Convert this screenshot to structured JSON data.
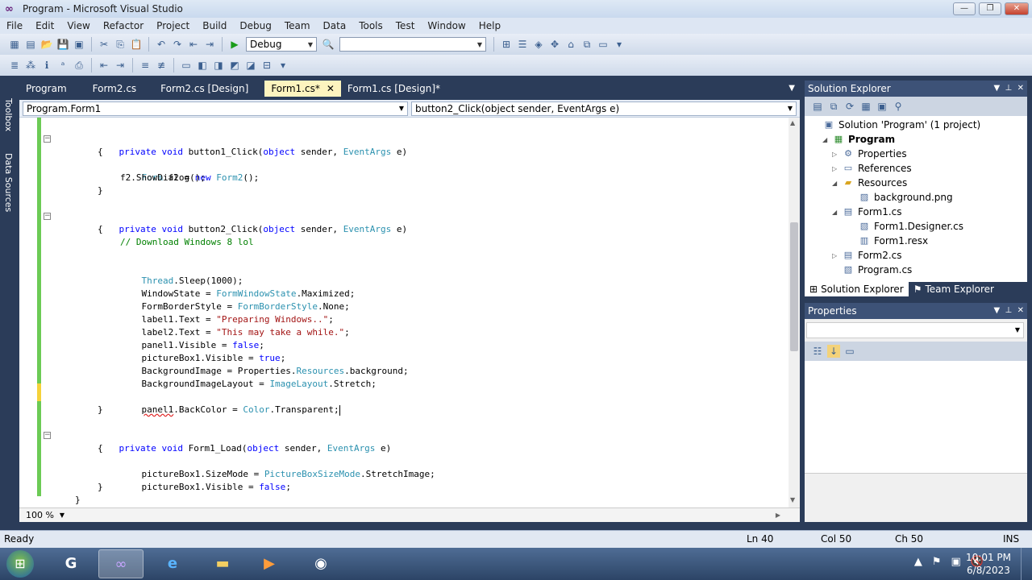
{
  "window": {
    "title": "Program - Microsoft Visual Studio",
    "app_icon": "vs-infinity-icon"
  },
  "menu": [
    "File",
    "Edit",
    "View",
    "Refactor",
    "Project",
    "Build",
    "Debug",
    "Team",
    "Data",
    "Tools",
    "Test",
    "Window",
    "Help"
  ],
  "toolbar": {
    "config": "Debug",
    "platform": ""
  },
  "left_strip": {
    "toolbox": "Toolbox",
    "data_sources": "Data Sources"
  },
  "doc_tabs": [
    {
      "label": "Program",
      "active": false
    },
    {
      "label": "Form2.cs",
      "active": false
    },
    {
      "label": "Form2.cs [Design]",
      "active": false
    },
    {
      "label": "Form1.cs*",
      "active": true
    },
    {
      "label": "Form1.cs [Design]*",
      "active": false
    }
  ],
  "nav": {
    "class_combo": "Program.Form1",
    "member_combo": "button2_Click(object sender, EventArgs e)"
  },
  "code": {
    "l01": "private void button1_Click(object sender, EventArgs e)",
    "l02": "{",
    "l03": "Form f2 = new Form2();",
    "l04": "f2.ShowDialog();",
    "l05": "}",
    "l06": "private void button2_Click(object sender, EventArgs e)",
    "l07": "{",
    "l08": "// Download Windows 8 lol",
    "l09": "Thread.Sleep(1000);",
    "l10": "WindowState = FormWindowState.Maximized;",
    "l11": "FormBorderStyle = FormBorderStyle.None;",
    "l12": "label1.Text = \"Preparing Windows..\";",
    "l13": "label2.Text = \"This may take a while.\";",
    "l14": "panel1.Visible = false;",
    "l15": "pictureBox1.Visible = true;",
    "l16": "BackgroundImage = Properties.Resources.background;",
    "l17": "BackgroundImageLayout = ImageLayout.Stretch;",
    "l18": "panel1.BackColor = Color.Transparent;",
    "l19": "}",
    "l20": "private void Form1_Load(object sender, EventArgs e)",
    "l21": "{",
    "l22": "pictureBox1.SizeMode = PictureBoxSizeMode.StretchImage;",
    "l23": "pictureBox1.Visible = false;",
    "l24": "}",
    "l25": "}"
  },
  "editor": {
    "zoom": "100 %"
  },
  "solution_explorer": {
    "title": "Solution Explorer",
    "tree": [
      {
        "label": "Solution 'Program' (1 project)",
        "icon": "solution-icon",
        "expander": "",
        "selected": false
      },
      {
        "label": "Program",
        "icon": "csharp-project-icon",
        "expander": "◢",
        "selected": true
      },
      {
        "label": "Properties",
        "icon": "properties-icon",
        "expander": "▷",
        "selected": false
      },
      {
        "label": "References",
        "icon": "references-icon",
        "expander": "▷",
        "selected": false
      },
      {
        "label": "Resources",
        "icon": "folder-icon",
        "expander": "◢",
        "selected": false
      },
      {
        "label": "background.png",
        "icon": "image-file-icon",
        "expander": "",
        "selected": false
      },
      {
        "label": "Form1.cs",
        "icon": "form-icon",
        "expander": "◢",
        "selected": false
      },
      {
        "label": "Form1.Designer.cs",
        "icon": "csharp-file-icon",
        "expander": "",
        "selected": false
      },
      {
        "label": "Form1.resx",
        "icon": "resx-file-icon",
        "expander": "",
        "selected": false
      },
      {
        "label": "Form2.cs",
        "icon": "form-icon",
        "expander": "▷",
        "selected": false
      },
      {
        "label": "Program.cs",
        "icon": "csharp-file-icon",
        "expander": "",
        "selected": false
      }
    ],
    "tabs": [
      "Solution Explorer",
      "Team Explorer"
    ]
  },
  "properties": {
    "title": "Properties"
  },
  "status": {
    "left": "Ready",
    "ln": "Ln 40",
    "col": "Col 50",
    "ch": "Ch 50",
    "mode": "INS"
  },
  "taskbar": {
    "time": "10:01 PM",
    "date": "6/8/2023"
  }
}
